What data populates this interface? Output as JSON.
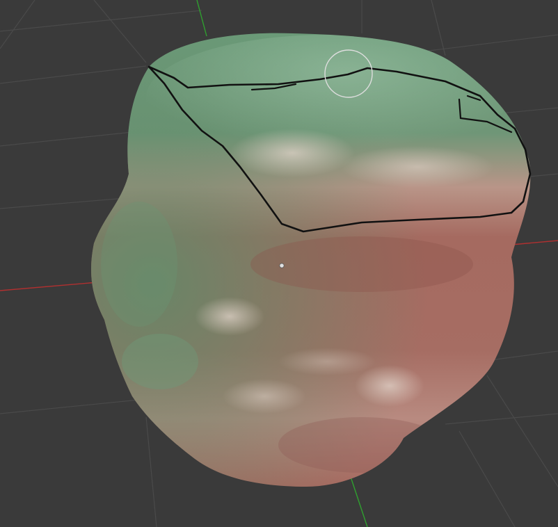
{
  "viewport": {
    "background": "#3a3a3a",
    "grid_color": "#4a4a4a",
    "x_axis_color": "#b03030",
    "y_axis_color": "#2fa02f"
  },
  "mesh": {
    "top_color": "#6b9a78",
    "body_color": "#a56a60",
    "highlight_color": "#e2d4ca",
    "stroke_color": "#111111"
  },
  "brush": {
    "icon": "brush-circle-cursor",
    "color": "#dddddd"
  },
  "pivot": {
    "icon": "origin-point-icon",
    "color": "#e0e0e0"
  }
}
